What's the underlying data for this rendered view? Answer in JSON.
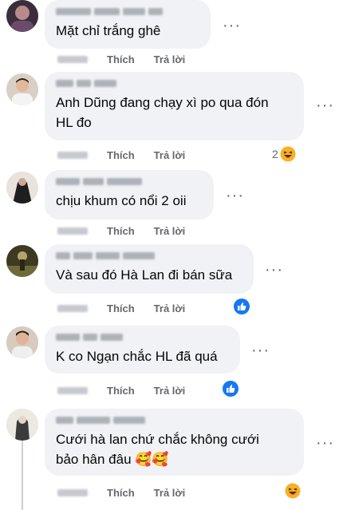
{
  "comments": [
    {
      "text": "Mặt chỉ trắng ghê",
      "like_label": "Thích",
      "reply_label": "Trả lời",
      "reaction": null
    },
    {
      "text": "Anh Dũng đang chạy xì po qua đón\nHL đo",
      "like_label": "Thích",
      "reply_label": "Trả lời",
      "reaction": {
        "icon": "haha-emoji-icon",
        "count": "2"
      }
    },
    {
      "text": "chịu khum có nổi 2 oii",
      "like_label": "Thích",
      "reply_label": "Trả lời",
      "reaction": null
    },
    {
      "text": "Và sau đó Hà Lan đi bán sữa",
      "like_label": "Thích",
      "reply_label": "Trả lời",
      "reaction": {
        "icon": "like-icon",
        "count": ""
      }
    },
    {
      "text": "K co Ngạn chắc HL đã quá",
      "like_label": "Thích",
      "reply_label": "Trả lời",
      "reaction": {
        "icon": "like-icon",
        "count": ""
      }
    },
    {
      "text": "Cưới hà lan chứ chắc không cưới\nbảo hân đâu 🥰🥰",
      "like_label": "Thích",
      "reply_label": "Trả lời",
      "reaction": {
        "icon": "haha-emoji-icon",
        "count": ""
      }
    }
  ],
  "more_label": "···",
  "colors": {
    "bubble": "#f0f2f5",
    "meta": "#65676b",
    "like_blue": "#1877f2",
    "haha_yellow": "#f7b125"
  }
}
